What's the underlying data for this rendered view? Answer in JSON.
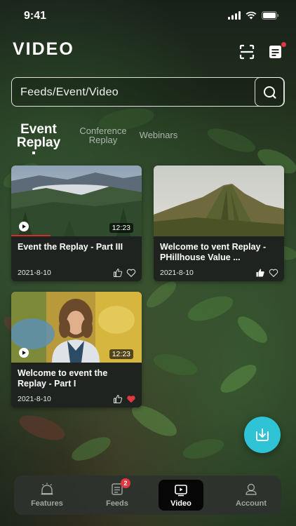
{
  "status_bar": {
    "time": "9:41"
  },
  "header": {
    "title": "VIDEO"
  },
  "search": {
    "placeholder": "Feeds/Event/Video"
  },
  "tabs": [
    {
      "line1": "Event",
      "line2": "Replay",
      "active": true
    },
    {
      "line1": "Conference",
      "line2": "Replay",
      "active": false
    },
    {
      "label": "Webinars",
      "active": false
    }
  ],
  "videos": [
    {
      "title": "Event the Replay - Part III",
      "date": "2021-8-10",
      "duration": "12:23",
      "progress": 0.3,
      "liked": false,
      "favorited": false
    },
    {
      "title": "Welcome to vent Replay - PHillhouse Value ...",
      "date": "2021-8-10",
      "liked": true,
      "favorited": false
    },
    {
      "title": "Welcome to event the Replay - Part I",
      "date": "2021-8-10",
      "duration": "12:23",
      "liked": false,
      "favorited": true
    }
  ],
  "nav": {
    "items": [
      {
        "label": "Features",
        "icon": "features-icon"
      },
      {
        "label": "Feeds",
        "icon": "feeds-icon",
        "badge": "2"
      },
      {
        "label": "Video",
        "icon": "video-icon",
        "active": true
      },
      {
        "label": "Account",
        "icon": "account-icon"
      }
    ]
  },
  "colors": {
    "accent": "#2fc3d6",
    "badge": "#e2383f",
    "heart": "#e2383f",
    "progress": "#d92d2d"
  }
}
